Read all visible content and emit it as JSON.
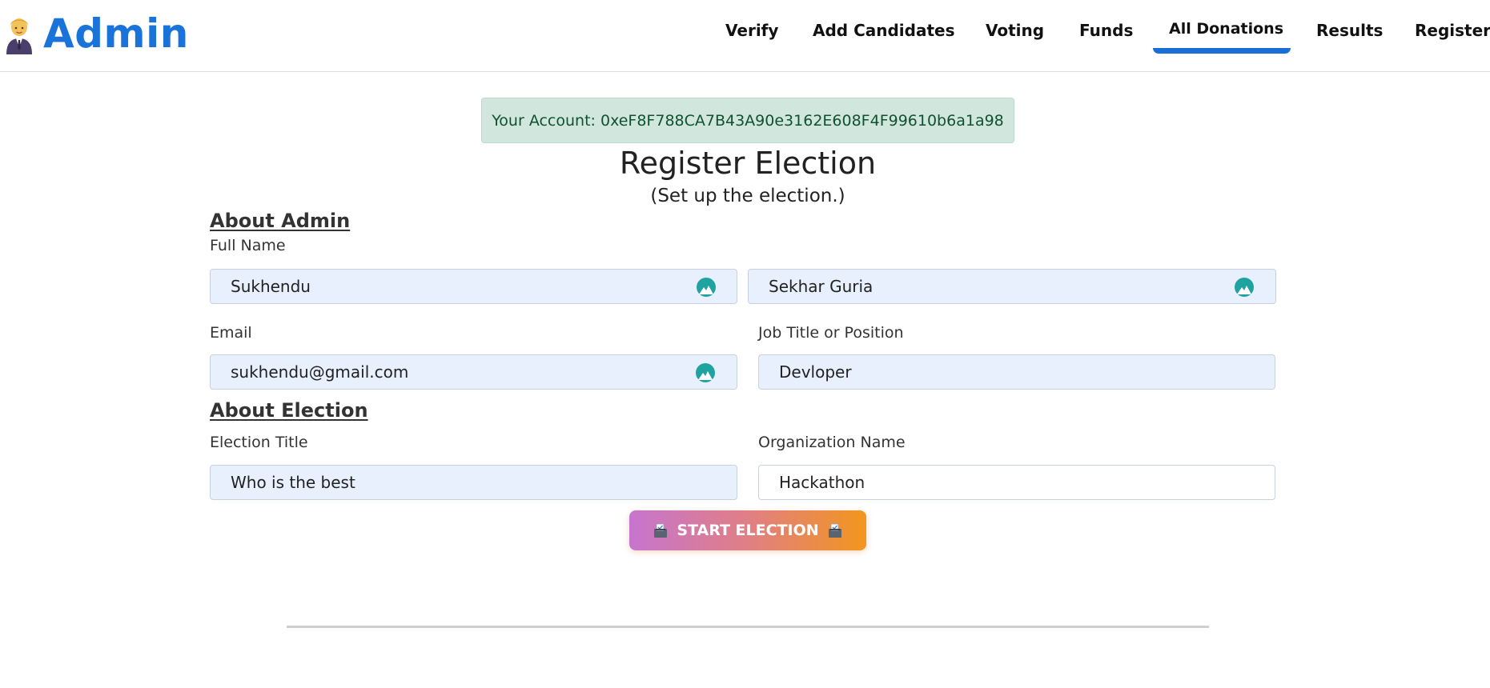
{
  "brand": {
    "title": "Admin",
    "icon": "admin-person-icon"
  },
  "nav": {
    "items": [
      {
        "label": "Verify"
      },
      {
        "label": "Add Candidates"
      },
      {
        "label": "Voting"
      },
      {
        "label": "Funds"
      },
      {
        "label": "All Donations",
        "active": true
      },
      {
        "label": "Results"
      },
      {
        "label": "Register"
      }
    ],
    "active_color": "#1a6fd6"
  },
  "account": {
    "text": "Your Account: 0xeF8F788CA7B43A90e3162E608F4F99610b6a1a98"
  },
  "page": {
    "title": "Register Election",
    "subtitle": "(Set up the election.)"
  },
  "about_admin": {
    "heading": "About Admin",
    "full_name_label": "Full Name",
    "first_name": "Sukhendu",
    "last_name": "Sekhar Guria",
    "email_label": "Email",
    "email": "sukhendu@gmail.com",
    "job_label": "Job Title or Position",
    "job": "Devloper"
  },
  "about_election": {
    "heading": "About Election",
    "election_title_label": "Election Title",
    "election_title": "Who is the best",
    "organization_label": "Organization Name",
    "organization": "Hackathon"
  },
  "actions": {
    "start_label": "START ELECTION",
    "start_icon": "ballot-box-icon"
  },
  "colors": {
    "brand": "#1a73d9",
    "alert_bg": "#d1e7dd",
    "alert_text": "#0f5132",
    "input_autofill_bg": "#e8f0fe",
    "autofill_icon": "#1fa3a0",
    "button_gradient_start": "#c675cf",
    "button_gradient_end": "#f2961e"
  }
}
